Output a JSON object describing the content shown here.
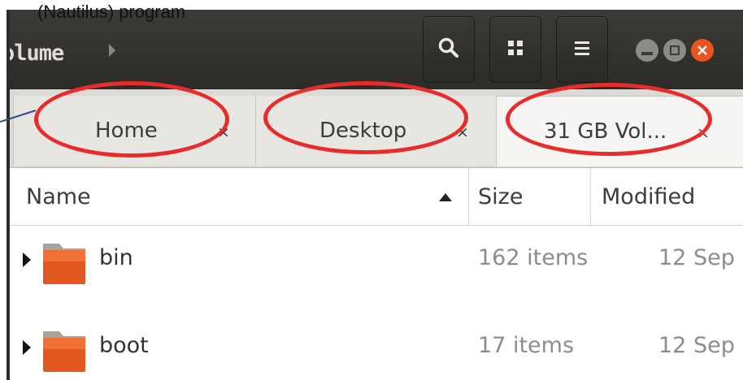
{
  "caption": "(Nautilus) program",
  "header": {
    "title": "olume",
    "path_forward_icon": "chevron-right-icon",
    "buttons": [
      {
        "name": "search",
        "icon": "search-icon"
      },
      {
        "name": "view",
        "icon": "grid-icon"
      },
      {
        "name": "menu",
        "icon": "hamburger-icon"
      }
    ],
    "window_controls": [
      {
        "name": "minimize",
        "icon": "minimize-icon",
        "color": "#8c8a84"
      },
      {
        "name": "maximize",
        "icon": "maximize-icon",
        "color": "#8c8a84"
      },
      {
        "name": "close",
        "icon": "close-icon",
        "color": "#e95420"
      }
    ]
  },
  "tabs": [
    {
      "label": "Home",
      "close": "×",
      "active": false
    },
    {
      "label": "Desktop",
      "close": "×",
      "active": false
    },
    {
      "label": "31 GB Vol...",
      "close": "×",
      "active": true
    }
  ],
  "annotation_color": "#e82b2b",
  "columns": {
    "name": "Name",
    "size": "Size",
    "modified": "Modified",
    "sort": "ascending"
  },
  "rows": [
    {
      "name": "bin",
      "size": "162 items",
      "modified": "12 Sep"
    },
    {
      "name": "boot",
      "size": "17 items",
      "modified": "12 Sep"
    }
  ]
}
